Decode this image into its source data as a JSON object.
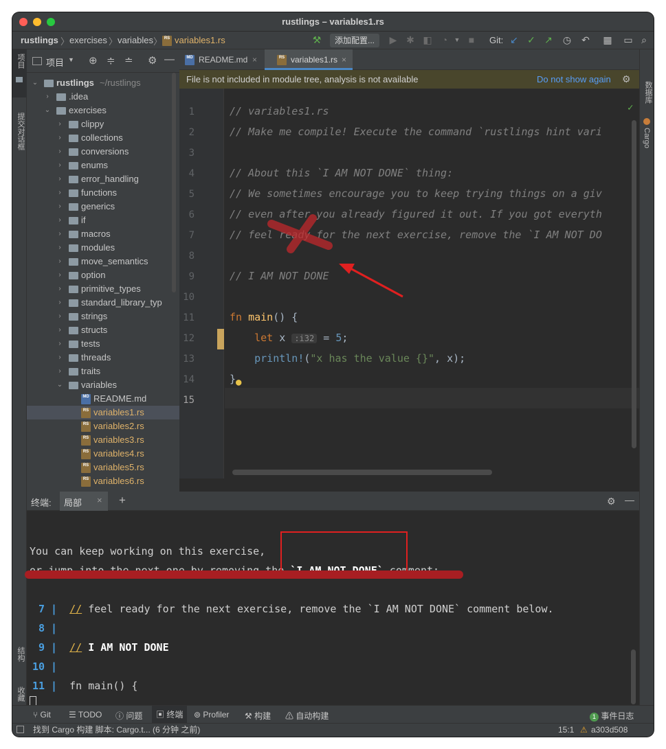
{
  "window": {
    "title": "rustlings – variables1.rs"
  },
  "breadcrumb": [
    "rustlings",
    "exercises",
    "variables",
    "variables1.rs"
  ],
  "toolbar": {
    "config_label": "添加配置...",
    "git_label": "Git:"
  },
  "sidebar_left": {
    "project_label": "项目",
    "commit_label": "提交对话框",
    "structure_label": "结构",
    "favorites_label": "收藏"
  },
  "sidebar_right": {
    "database_label": "数据库",
    "cargo_label": "Cargo"
  },
  "project_panel": {
    "header_label": "项目",
    "root": {
      "name": "rustlings",
      "path": "~/rustlings"
    },
    "idea": ".idea",
    "exercises": "exercises",
    "folders": [
      "clippy",
      "collections",
      "conversions",
      "enums",
      "error_handling",
      "functions",
      "generics",
      "if",
      "macros",
      "modules",
      "move_semantics",
      "option",
      "primitive_types",
      "standard_library_typ",
      "strings",
      "structs",
      "tests",
      "threads",
      "traits",
      "variables"
    ],
    "files": [
      "README.md",
      "variables1.rs",
      "variables2.rs",
      "variables3.rs",
      "variables4.rs",
      "variables5.rs",
      "variables6.rs"
    ]
  },
  "tabs": [
    {
      "label": "README.md"
    },
    {
      "label": "variables1.rs"
    }
  ],
  "banner": {
    "message": "File is not included in module tree, analysis is not available",
    "action": "Do not show again"
  },
  "editor": {
    "line_numbers": [
      "1",
      "2",
      "3",
      "4",
      "5",
      "6",
      "7",
      "8",
      "9",
      "10",
      "11",
      "12",
      "13",
      "14",
      "15"
    ],
    "lines": {
      "l1": "// variables1.rs",
      "l2": "// Make me compile! Execute the command `rustlings hint vari",
      "l4": "// About this `I AM NOT DONE` thing:",
      "l5": "// We sometimes encourage you to keep trying things on a giv",
      "l6": "// even after you already figured it out. If you got everyth",
      "l7": "// feel ready for the next exercise, remove the `I AM NOT DO",
      "l9": "// I AM NOT DONE",
      "l11_kw": "fn",
      "l11_fn": "main",
      "l11_rest": "() {",
      "l12_kw": "let",
      "l12_var": "x",
      "l12_hint": ":i32",
      "l12_eq": "=",
      "l12_num": "5",
      "l12_end": ";",
      "l13_mac": "println!",
      "l13_str": "\"x has the value {}\"",
      "l13_rest": ", x);",
      "l14": "}"
    }
  },
  "terminal": {
    "label": "终端:",
    "tab_label": "局部",
    "line1": "You can keep working on this exercise,",
    "line2_a": "or jump into the next one by removing the ",
    "line2_b": "`I AM NOT DONE`",
    "line2_c": " comment:",
    "rows": [
      {
        "num": "7",
        "bar": "|",
        "slashes": "//",
        "text": " feel ready for the next exercise, remove the `I AM NOT DONE` comment below."
      },
      {
        "num": "8",
        "bar": "|",
        "slashes": "",
        "text": ""
      },
      {
        "num": "9",
        "bar": "|",
        "slashes": "//",
        "text": " I AM NOT DONE"
      },
      {
        "num": "10",
        "bar": "|",
        "slashes": "",
        "text": ""
      },
      {
        "num": "11",
        "bar": "|",
        "slashes": "",
        "text": "fn main() {"
      }
    ]
  },
  "bottom_tools": {
    "git": "Git",
    "todo": "TODO",
    "problems": "问题",
    "terminal": "终端",
    "profiler": "Profiler",
    "build": "构建",
    "autobuild": "自动构建",
    "event_count": "1",
    "event_log": "事件日志"
  },
  "status": {
    "message": "找到 Cargo 构建 脚本: Cargo.t... (6 分钟 之前)",
    "position": "15:1",
    "branch": "a303d508"
  },
  "colors": {
    "accent": "#4a88c7",
    "annotation": "#e02020",
    "warning_bg": "#49462c"
  }
}
